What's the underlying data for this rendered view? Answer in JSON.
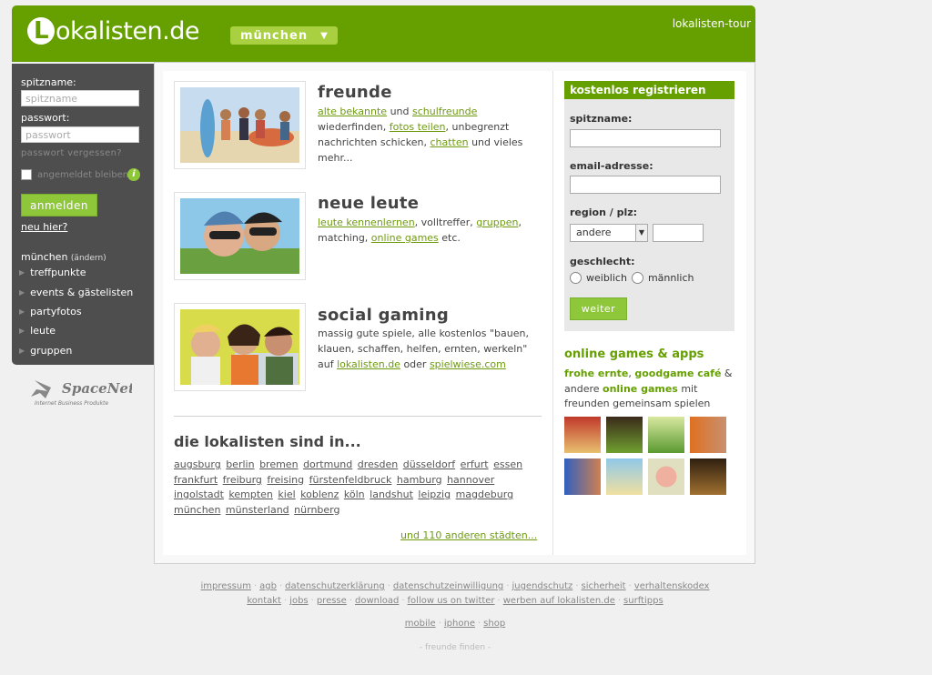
{
  "header": {
    "logo_text": "okalisten.de",
    "logo_letter": "L",
    "city_select": "münchen",
    "tour_link": "lokalisten-tour"
  },
  "login": {
    "username_label": "spitzname:",
    "username_placeholder": "spitzname",
    "password_label": "passwort:",
    "password_placeholder": "passwort",
    "forgot": "passwort vergessen?",
    "remember": "angemeldet bleiben",
    "button": "anmelden",
    "new_here": "neu hier?"
  },
  "city_nav": {
    "city": "münchen",
    "change": "(ändern)",
    "items": [
      "treffpunkte",
      "events & gästelisten",
      "partyfotos",
      "leute",
      "gruppen"
    ]
  },
  "sponsor": {
    "name": "SpaceNet",
    "tagline": "Internet Business Produkte"
  },
  "features": [
    {
      "title": "freunde",
      "segments": [
        {
          "t": "alte bekannte",
          "link": true
        },
        {
          "t": " und ",
          "link": false
        },
        {
          "t": "schulfreunde",
          "link": true
        },
        {
          "t": " wiederfinden, ",
          "link": false
        },
        {
          "t": "fotos teilen",
          "link": true
        },
        {
          "t": ", unbegrenzt nachrichten schicken, ",
          "link": false
        },
        {
          "t": "chatten",
          "link": true
        },
        {
          "t": " und vieles mehr...",
          "link": false
        }
      ]
    },
    {
      "title": "neue leute",
      "segments": [
        {
          "t": "leute kennenlernen",
          "link": true
        },
        {
          "t": ", volltreffer, ",
          "link": false
        },
        {
          "t": "gruppen",
          "link": true
        },
        {
          "t": ", matching, ",
          "link": false
        },
        {
          "t": "online games",
          "link": true
        },
        {
          "t": " etc.",
          "link": false
        }
      ]
    },
    {
      "title": "social gaming",
      "segments": [
        {
          "t": "massig gute spiele, alle kostenlos \"bauen, klauen, schaffen, helfen, ernten, werkeln\" auf ",
          "link": false
        },
        {
          "t": "lokalisten.de",
          "link": true
        },
        {
          "t": " oder ",
          "link": false
        },
        {
          "t": "spielwiese.com",
          "link": true
        }
      ]
    }
  ],
  "cities": {
    "title": "die lokalisten sind in...",
    "list": [
      "augsburg",
      "berlin",
      "bremen",
      "dortmund",
      "dresden",
      "düsseldorf",
      "erfurt",
      "essen",
      "frankfurt",
      "freiburg",
      "freising",
      "fürstenfeldbruck",
      "hamburg",
      "hannover",
      "ingolstadt",
      "kempten",
      "kiel",
      "koblenz",
      "köln",
      "landshut",
      "leipzig",
      "magdeburg",
      "münchen",
      "münsterland",
      "nürnberg"
    ],
    "more": "und 110 anderen städten..."
  },
  "register": {
    "title": "kostenlos registrieren",
    "nick_label": "spitzname:",
    "email_label": "email-adresse:",
    "region_label": "region / plz:",
    "region_value": "andere",
    "gender_label": "geschlecht:",
    "female": "weiblich",
    "male": "männlich",
    "button": "weiter"
  },
  "games": {
    "title": "online games & apps",
    "game1": "frohe ernte",
    "comma": ", ",
    "game2": "goodgame café",
    "mid": " & andere ",
    "game3": "online games",
    "tail": " mit freunden gemeinsam spielen"
  },
  "footer": {
    "row1": [
      "impressum",
      "agb",
      "datenschutzerklärung",
      "datenschutzeinwilligung",
      "jugendschutz",
      "sicherheit",
      "verhaltenskodex"
    ],
    "row2": [
      "kontakt",
      "jobs",
      "presse",
      "download",
      "follow us on twitter",
      "werben auf lokalisten.de",
      "surftipps"
    ],
    "row3": [
      "mobile",
      "iphone",
      "shop"
    ],
    "tagline": "- freunde finden -"
  },
  "colors": {
    "brand_green": "#65a000",
    "button_green": "#8ec73a",
    "sidebar": "#4e4e4e",
    "link_green": "#6e9a10"
  }
}
